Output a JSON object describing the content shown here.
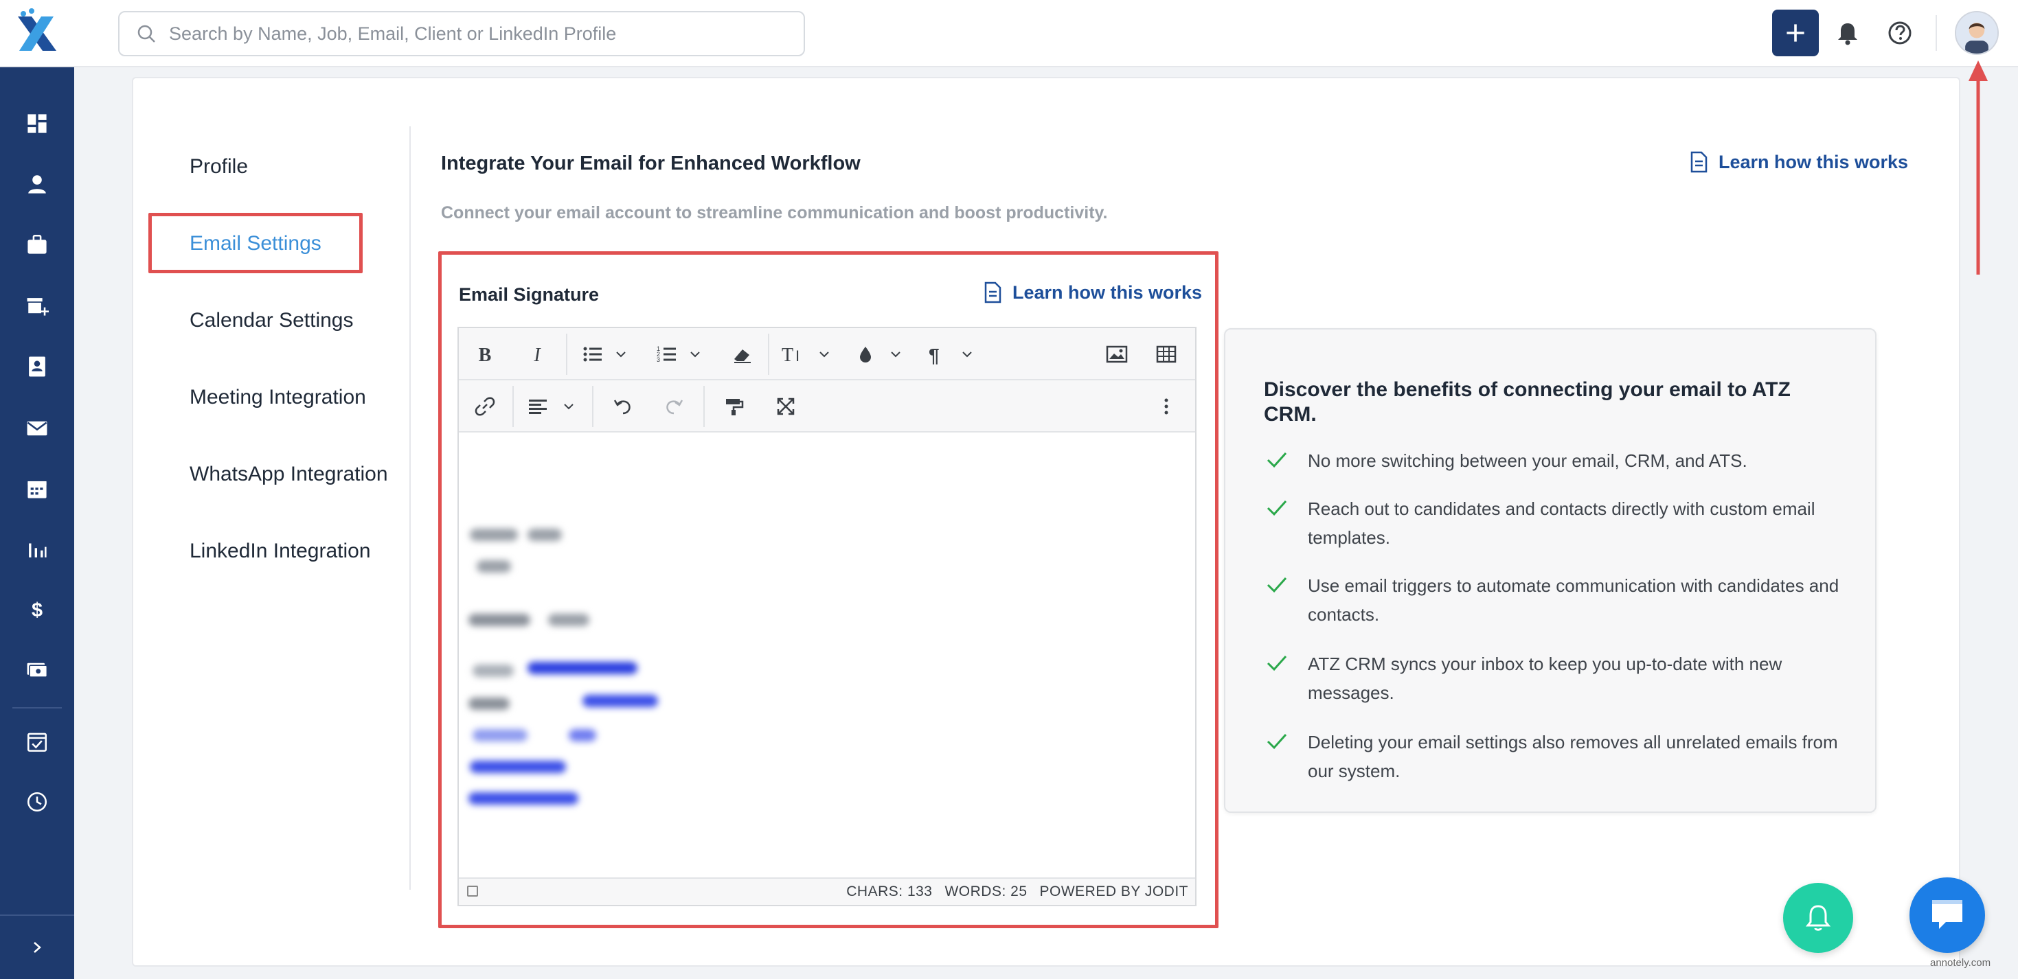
{
  "search": {
    "placeholder": "Search by Name, Job, Email, Client or LinkedIn Profile"
  },
  "settings_nav": [
    {
      "label": "Profile"
    },
    {
      "label": "Email Settings"
    },
    {
      "label": "Calendar Settings"
    },
    {
      "label": "Meeting Integration"
    },
    {
      "label": "WhatsApp Integration"
    },
    {
      "label": "LinkedIn Integration"
    }
  ],
  "main": {
    "title": "Integrate Your Email for Enhanced Workflow",
    "subtitle": "Connect your email account to streamline communication and boost productivity.",
    "learn_link": "Learn how this works"
  },
  "editor": {
    "label": "Email Signature",
    "learn_link": "Learn how this works",
    "status": {
      "chars": "CHARS: 133",
      "words": "WORDS: 25",
      "powered": "POWERED BY JODIT"
    }
  },
  "benefits": {
    "title": "Discover the benefits of connecting your email to ATZ CRM.",
    "items": [
      "No more switching between your email, CRM, and ATS.",
      "Reach out to candidates and contacts directly with custom email templates.",
      "Use email triggers to automate communication with candidates and contacts.",
      "ATZ CRM syncs your inbox to keep you up-to-date with new messages.",
      "Deleting your email settings also removes all unrelated emails from our system."
    ]
  },
  "watermark": "annotely.com",
  "colors": {
    "sidebar": "#1e3a6e",
    "accent": "#3b8fd8",
    "highlight": "#e05050",
    "check": "#2aa84a",
    "fab_bell": "#22d0a5",
    "fab_chat": "#1c7ee6"
  }
}
